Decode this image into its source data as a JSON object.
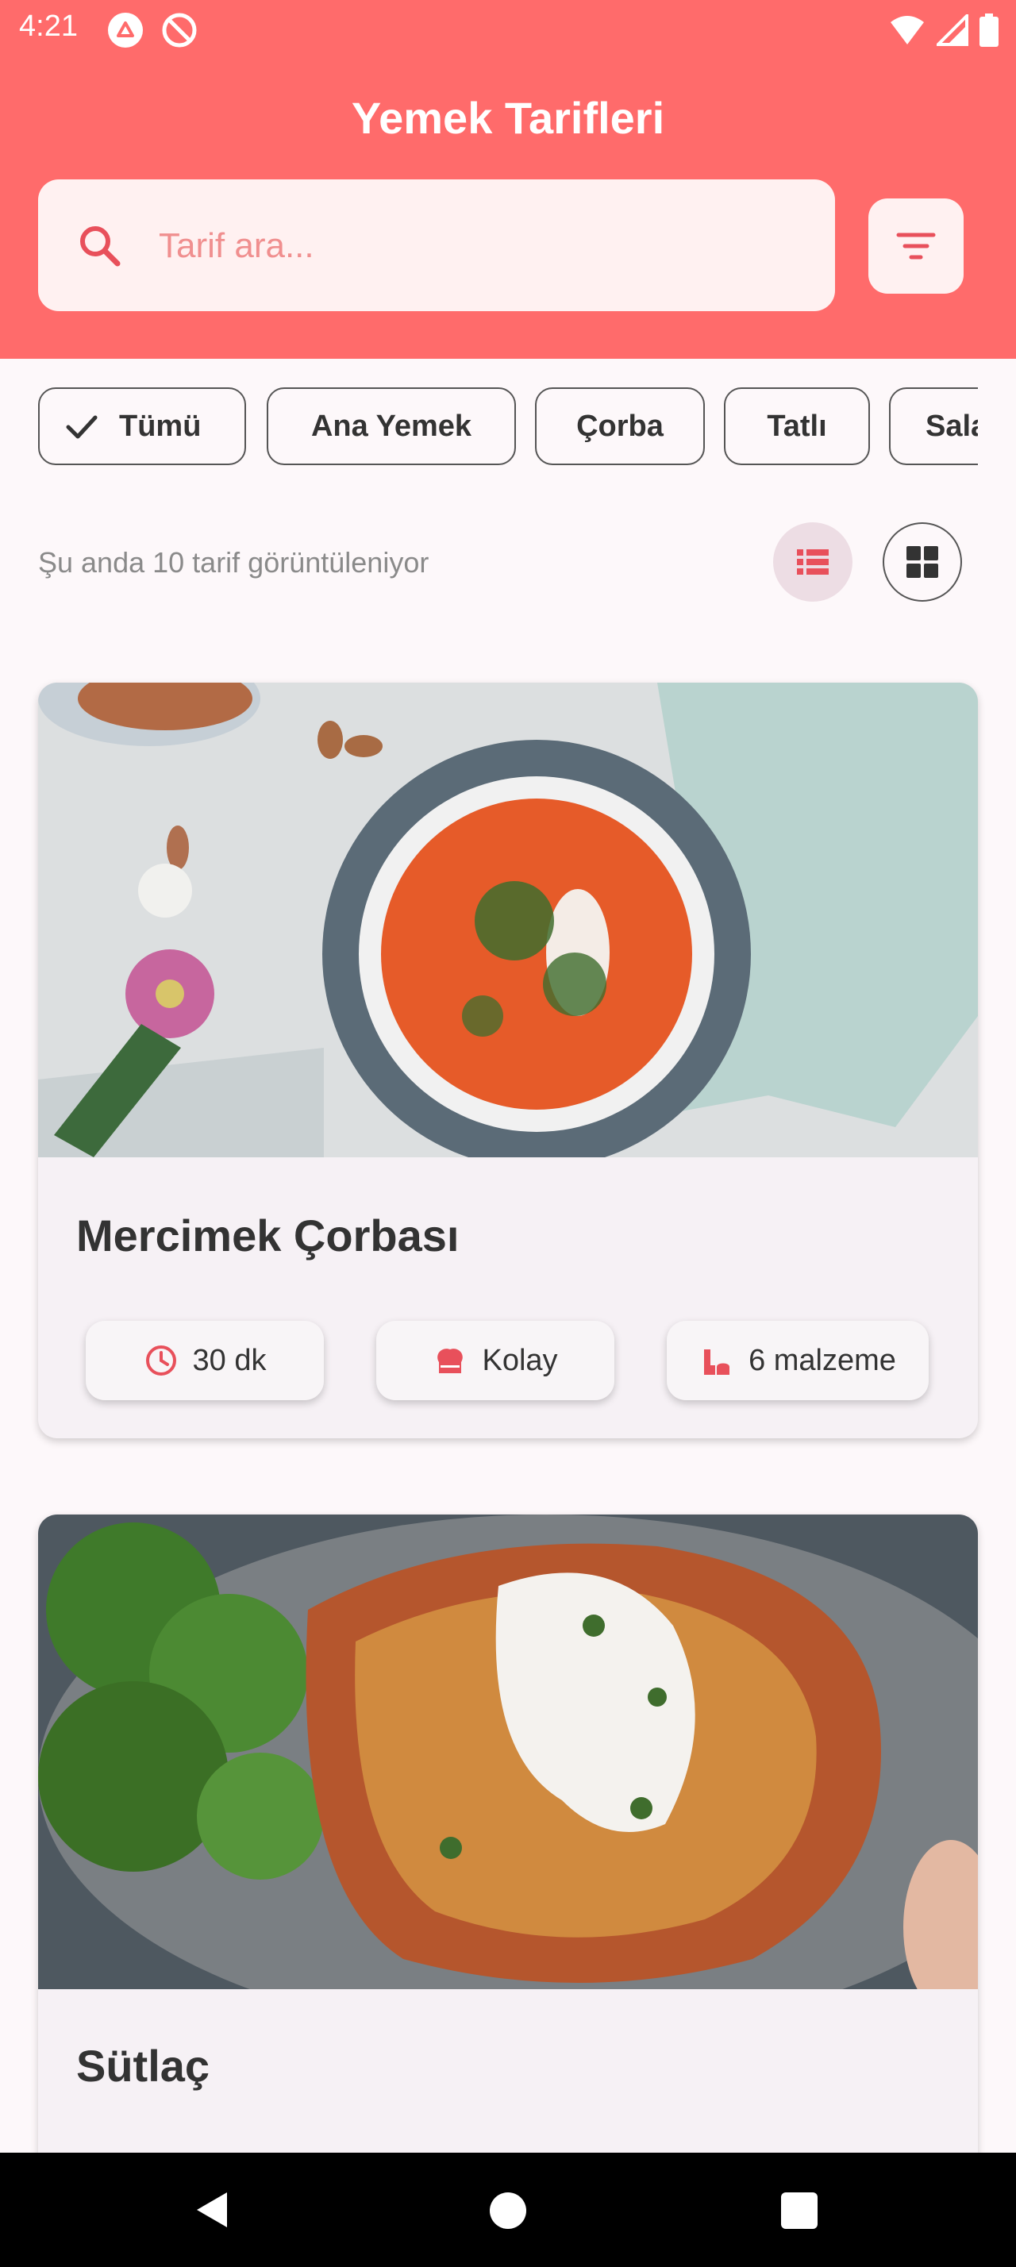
{
  "status_bar": {
    "time": "4:21"
  },
  "header": {
    "title": "Yemek Tarifleri",
    "search_placeholder": "Tarif ara..."
  },
  "categories": [
    {
      "label": "Tümü",
      "selected": true
    },
    {
      "label": "Ana Yemek",
      "selected": false
    },
    {
      "label": "Çorba",
      "selected": false
    },
    {
      "label": "Tatlı",
      "selected": false
    },
    {
      "label": "Salata",
      "selected": false
    }
  ],
  "listing": {
    "count_text": "Şu anda 10 tarif görüntüleniyor",
    "view_mode": "list"
  },
  "recipes": [
    {
      "title": "Mercimek Çorbası",
      "time": "30 dk",
      "difficulty": "Kolay",
      "ingredients": "6 malzeme",
      "image": "tomato-soup-photo"
    },
    {
      "title": "Sütlaç",
      "image": "chicken-parmesan-photo"
    }
  ],
  "colors": {
    "primary": "#ff6b6b",
    "search_bg": "#fff1f1",
    "background": "#fdf8fa",
    "card_bg": "#f6f1f5",
    "icon_accent": "#e8505b"
  }
}
